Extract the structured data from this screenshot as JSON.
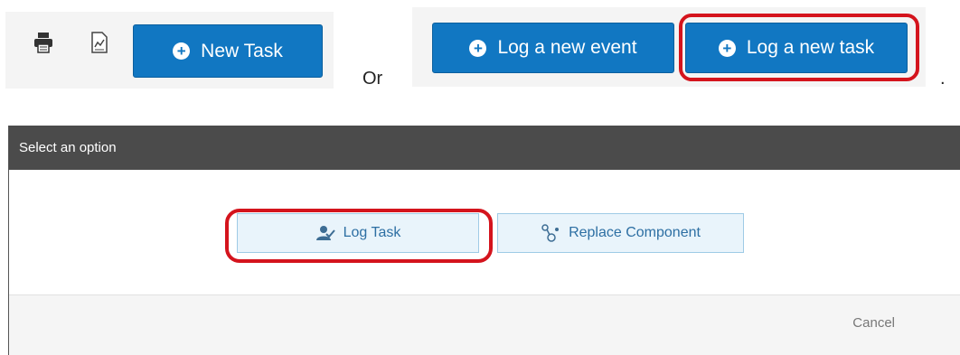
{
  "toolbar_a": {
    "print_icon": "printer-icon",
    "report_icon": "report-chart-icon",
    "new_task_label": "New Task"
  },
  "separator": {
    "or_label": "Or",
    "period": "."
  },
  "toolbar_b": {
    "log_event_label": "Log a new event",
    "log_task_label": "Log a new task"
  },
  "dialog": {
    "title": "Select an option",
    "log_task_label": "Log Task",
    "replace_component_label": "Replace Component",
    "cancel_label": "Cancel"
  },
  "colors": {
    "primary_button": "#1177c2",
    "highlight": "#d4141d",
    "dialog_header": "#4b4b4b",
    "option_button_bg": "#e9f4fb"
  }
}
